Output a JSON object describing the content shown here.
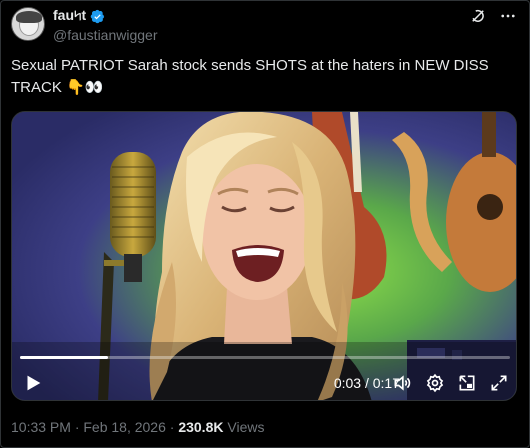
{
  "author": {
    "display_name": "fau৸t",
    "handle": "@faustianwigger",
    "verified": true
  },
  "icons": {
    "verified": "verified-badge-icon",
    "grok": "grok-icon",
    "more": "more-icon",
    "play": "play-icon",
    "volume": "volume-icon",
    "settings": "settings-icon",
    "pip": "picture-in-picture-icon",
    "fullscreen": "fullscreen-icon"
  },
  "tweet": {
    "text": "Sexual PATRIOT Sarah stock sends SHOTS at the haters in NEW DISS TRACK 👇👀"
  },
  "video": {
    "current_time": "0:03",
    "duration": "0:17",
    "time_display": "0:03 / 0:17",
    "progress_fraction": 0.18
  },
  "footer": {
    "timestamp": "10:33 PM · Feb 18, 2026",
    "separator": " · ",
    "views_count": "230.8K",
    "views_label": " Views"
  },
  "colors": {
    "background": "#000000",
    "text_primary": "#e7e9ea",
    "text_secondary": "#71767b",
    "verified_blue": "#1d9bf0",
    "border": "#2f3336"
  }
}
